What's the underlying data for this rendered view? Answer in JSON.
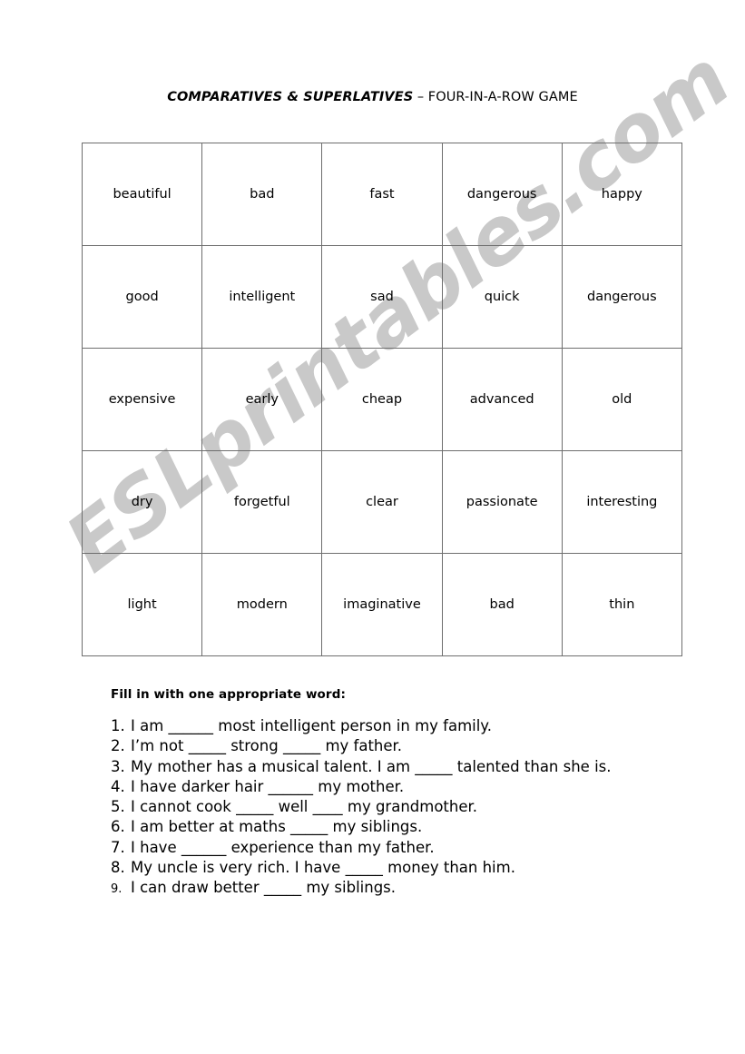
{
  "document": {
    "title_main": "COMPARATIVES & SUPERLATIVES",
    "title_dash": " – ",
    "title_sub": "FOUR-IN-A-ROW GAME"
  },
  "watermark": {
    "text": "ESLprintables.com",
    "color": "#c9c9c9"
  },
  "grid": {
    "rows": [
      [
        "beautiful",
        "bad",
        "fast",
        "dangerous",
        "happy"
      ],
      [
        "good",
        "intelligent",
        "sad",
        "quick",
        "dangerous"
      ],
      [
        "expensive",
        "early",
        "cheap",
        "advanced",
        "old"
      ],
      [
        "dry",
        "forgetful",
        "clear",
        "passionate",
        "interesting"
      ],
      [
        "light",
        "modern",
        "imaginative",
        "bad",
        "thin"
      ]
    ]
  },
  "exercise": {
    "instructions": "Fill in with one appropriate word:",
    "items": [
      {
        "number": "1.",
        "text": "I am ______ most intelligent person in my family."
      },
      {
        "number": "2.",
        "text": "I’m not _____ strong _____ my father."
      },
      {
        "number": "3.",
        "text": "My mother has a musical talent. I am _____ talented than she is."
      },
      {
        "number": "4.",
        "text": "I have darker hair ______ my mother."
      },
      {
        "number": "5.",
        "text": "I cannot cook _____ well ____ my grandmother."
      },
      {
        "number": "6.",
        "text": "I am better at maths _____ my siblings."
      },
      {
        "number": "7.",
        "text": "I have ______ experience than my father."
      },
      {
        "number": "8.",
        "text": "My uncle is very rich. I have _____ money than him."
      },
      {
        "number": "9.",
        "text": "I can draw better _____ my siblings."
      }
    ]
  }
}
